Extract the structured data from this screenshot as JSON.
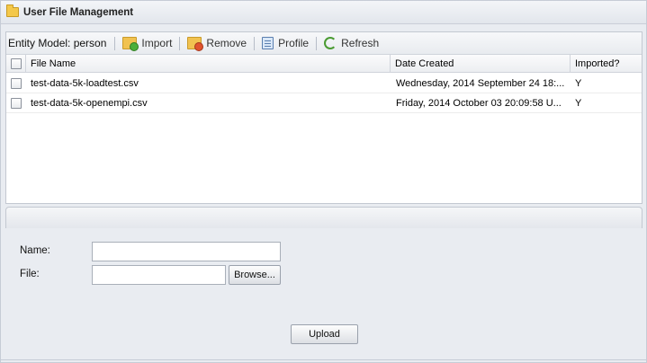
{
  "window": {
    "title": "User File Management"
  },
  "toolbar": {
    "entity_model_label": "Entity Model: person",
    "import_label": "Import",
    "remove_label": "Remove",
    "profile_label": "Profile",
    "refresh_label": "Refresh"
  },
  "grid": {
    "columns": [
      "File Name",
      "Date Created",
      "Imported?"
    ],
    "rows": [
      {
        "file_name": "test-data-5k-loadtest.csv",
        "date_created": "Wednesday, 2014 September 24 18:...",
        "imported": "Y",
        "checked": false
      },
      {
        "file_name": "test-data-5k-openempi.csv",
        "date_created": "Friday, 2014 October 03 20:09:58 U...",
        "imported": "Y",
        "checked": false
      }
    ]
  },
  "form": {
    "name_label": "Name:",
    "name_value": "",
    "file_label": "File:",
    "file_value": "",
    "browse_label": "Browse...",
    "upload_label": "Upload"
  },
  "icons": {
    "title": "folder-icon",
    "import": "import-icon",
    "remove": "remove-icon",
    "profile": "profile-icon",
    "refresh": "refresh-icon"
  }
}
